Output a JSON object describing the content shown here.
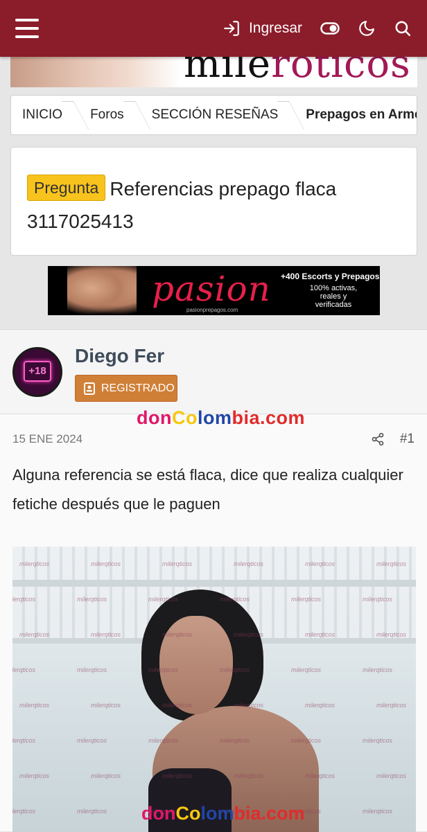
{
  "header": {
    "menu_icon": "hamburger-menu-icon",
    "login_label": "Ingresar",
    "icons": [
      "login-icon",
      "toggle-icon",
      "moon-icon",
      "search-icon"
    ],
    "brand_color": "#8b1c2a"
  },
  "top_banner": {
    "logo_left": "mile",
    "logo_accent": "róticos"
  },
  "breadcrumb": {
    "items": [
      {
        "label": "INICIO"
      },
      {
        "label": "Foros"
      },
      {
        "label": "SECCIÓN RESEÑAS"
      },
      {
        "label": "Prepagos en Armenia"
      }
    ]
  },
  "thread": {
    "prefix": "Pregunta",
    "title": "Referencias prepago flaca 3117025413",
    "prefix_color": "#f8c31c"
  },
  "ad": {
    "brand": "pasion",
    "url": "pasionprepagos.com",
    "headline": "+400 Escorts y Prepagos",
    "subline": "100% activas, reales y verificadas"
  },
  "post": {
    "author": "Diego Fer",
    "avatar_label": "+18",
    "role": "REGISTRADO",
    "role_color": "#d07f36",
    "watermark_parts": [
      "don",
      "Co",
      "lom",
      "bia.com"
    ],
    "date": "15 ENE 2024",
    "post_number": "#1",
    "message": "Alguna referencia se está flaca, dice que realiza cualquier fetiche después que le paguen",
    "photo_watermark": "milerqticos"
  }
}
